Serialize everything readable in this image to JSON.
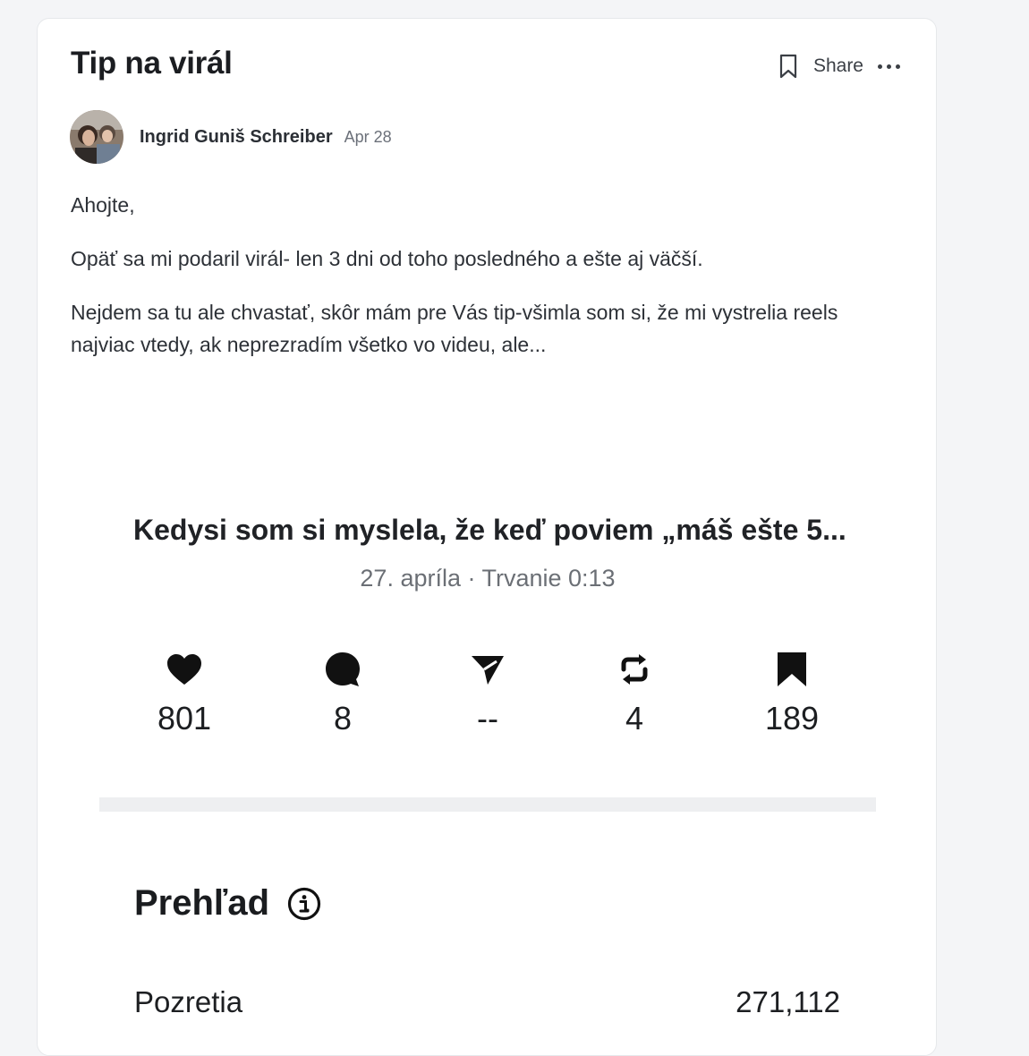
{
  "post": {
    "title": "Tip na virál",
    "share_label": "Share",
    "author": "Ingrid Guniš Schreiber",
    "date": "Apr 28",
    "paragraphs": [
      "Ahojte,",
      "Opäť sa mi podaril virál- len 3 dni od toho posledného a ešte aj väčší.",
      "Nejdem sa tu ale chvastať, skôr mám pre Vás tip-všimla som si, že mi vystrelia reels najviac vtedy, ak neprezradím všetko vo videu, ale..."
    ]
  },
  "embed": {
    "reel_title": "Kedysi som si myslela, že keď poviem „máš ešte 5...",
    "subtitle": "27. apríla · Trvanie 0:13",
    "stats": [
      {
        "icon": "heart-icon",
        "value": "801"
      },
      {
        "icon": "comment-icon",
        "value": "8"
      },
      {
        "icon": "send-icon",
        "value": "--"
      },
      {
        "icon": "repost-icon",
        "value": "4"
      },
      {
        "icon": "saved-icon",
        "value": "189"
      }
    ],
    "overview": {
      "title": "Prehľad",
      "metric_label": "Pozretia",
      "metric_value": "271,112"
    }
  },
  "colors": {
    "background": "#f4f5f7",
    "card": "#ffffff",
    "text": "#1f2328",
    "muted": "#6b7079"
  }
}
